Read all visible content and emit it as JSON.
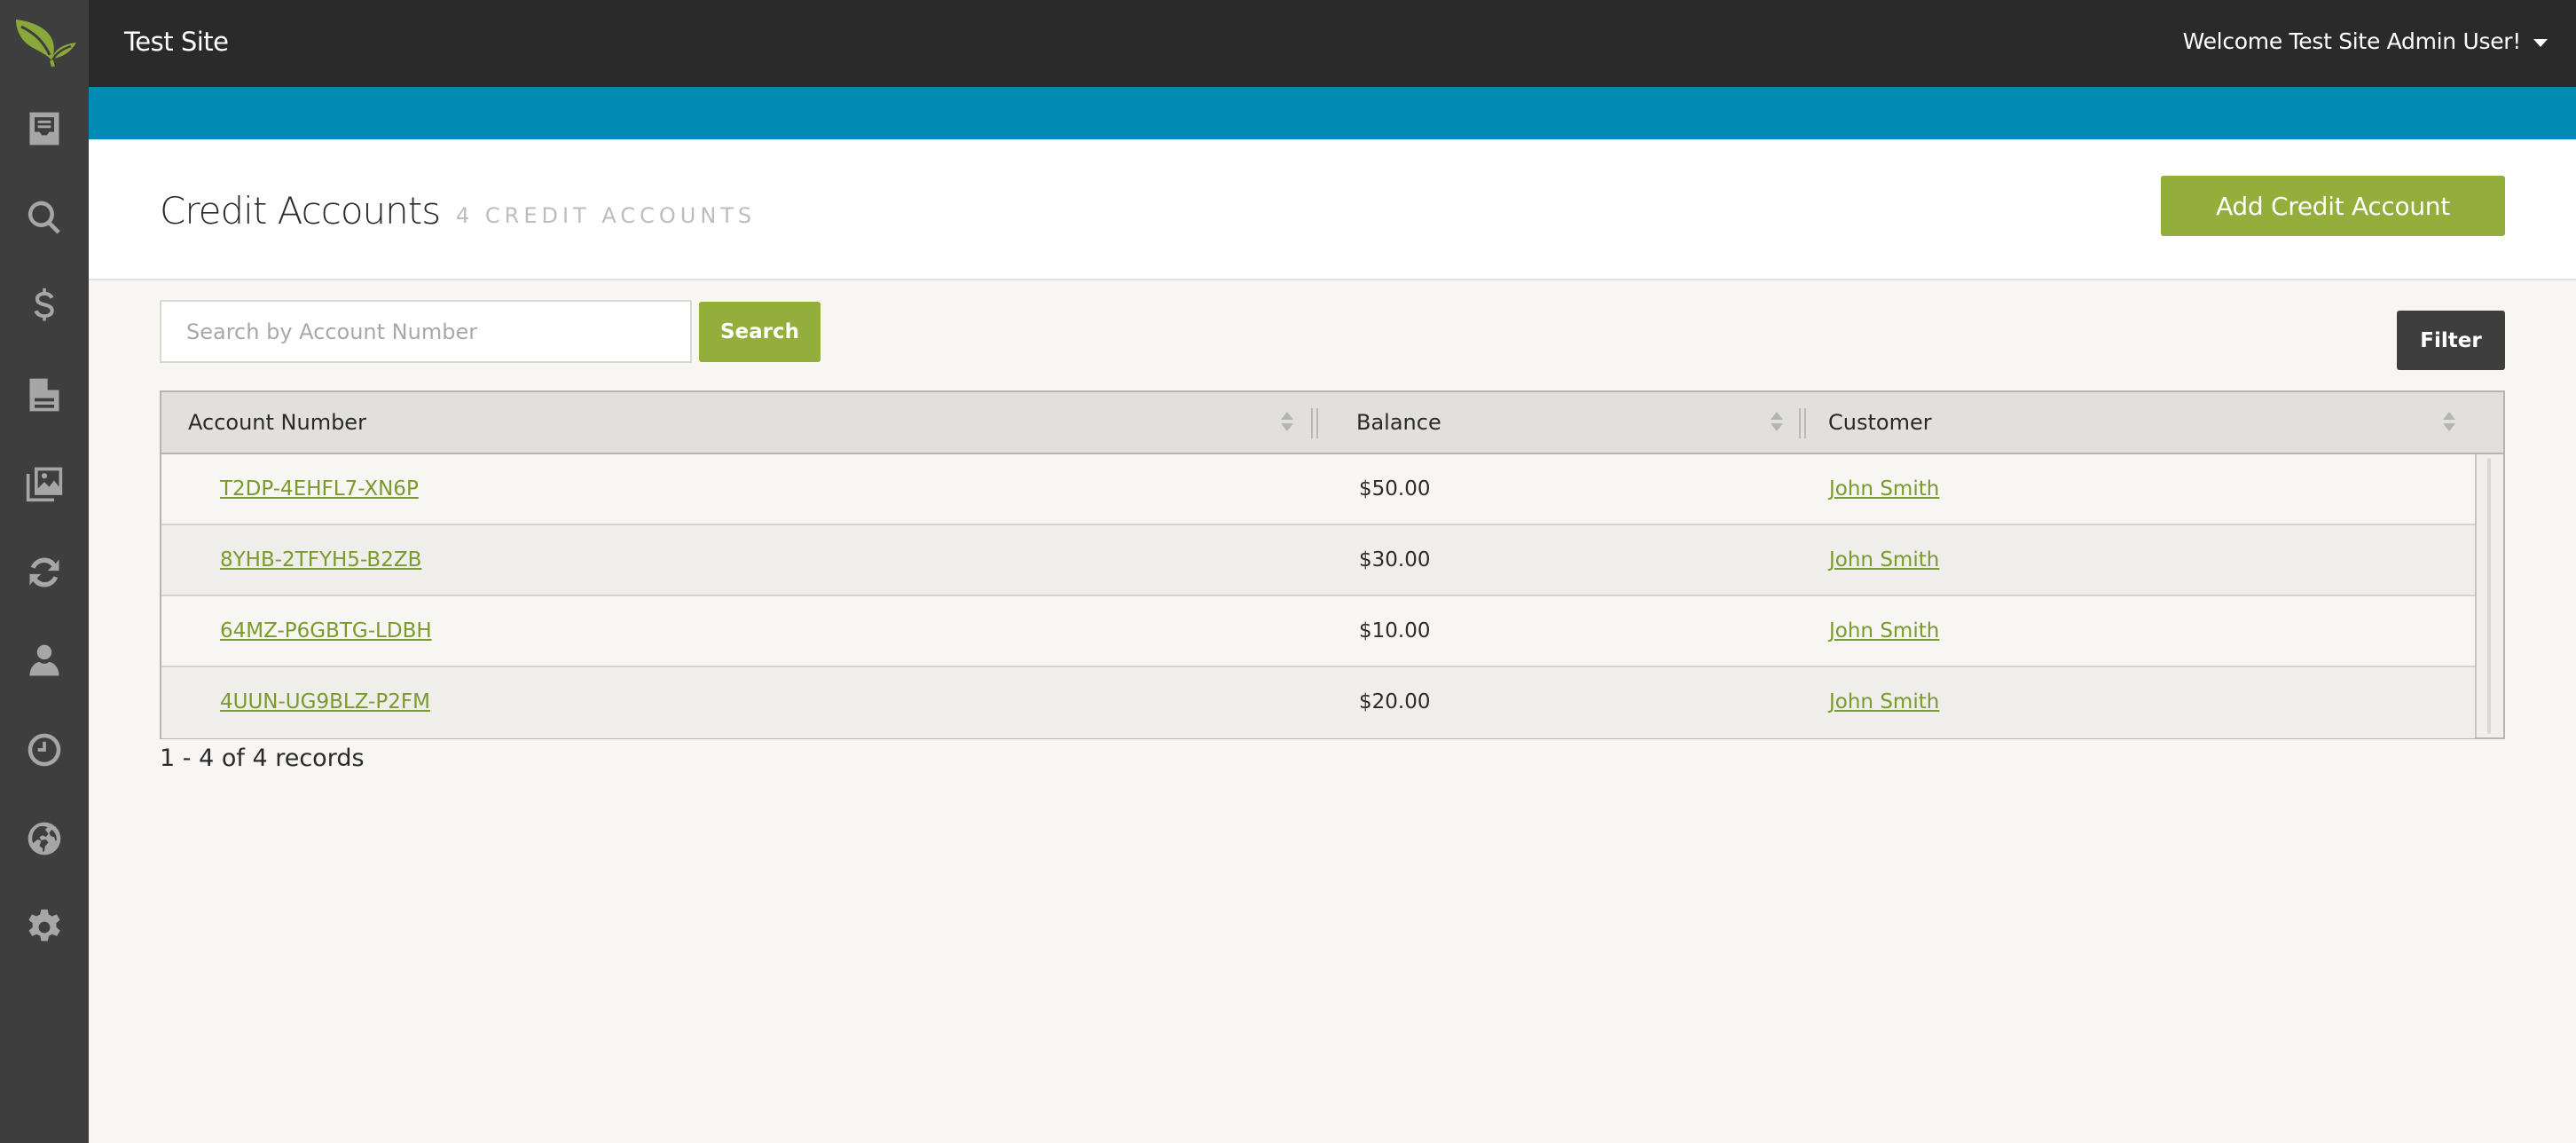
{
  "app": {
    "site_title": "Test Site",
    "user_greeting": "Welcome Test Site Admin User!"
  },
  "sidebar": {
    "items": [
      {
        "name": "orders",
        "icon": "inbox-icon"
      },
      {
        "name": "search",
        "icon": "search-icon"
      },
      {
        "name": "billing",
        "icon": "dollar-icon"
      },
      {
        "name": "pages",
        "icon": "document-icon"
      },
      {
        "name": "media",
        "icon": "images-icon"
      },
      {
        "name": "sync",
        "icon": "refresh-icon"
      },
      {
        "name": "users",
        "icon": "user-icon"
      },
      {
        "name": "history",
        "icon": "clock-icon"
      },
      {
        "name": "sites",
        "icon": "globe-icon"
      },
      {
        "name": "settings",
        "icon": "gear-icon"
      }
    ]
  },
  "page": {
    "title": "Credit Accounts",
    "count_label": "4 Credit Accounts",
    "add_button": "Add Credit Account"
  },
  "search": {
    "placeholder": "Search by Account Number",
    "value": "",
    "button": "Search"
  },
  "filter": {
    "button": "Filter"
  },
  "table": {
    "columns": [
      "Account Number",
      "Balance",
      "Customer"
    ],
    "rows": [
      {
        "account_number": "T2DP-4EHFL7-XN6P",
        "balance": "$50.00",
        "customer": "John Smith"
      },
      {
        "account_number": "8YHB-2TFYH5-B2ZB",
        "balance": "$30.00",
        "customer": "John Smith"
      },
      {
        "account_number": "64MZ-P6GBTG-LDBH",
        "balance": "$10.00",
        "customer": "John Smith"
      },
      {
        "account_number": "4UUN-UG9BLZ-P2FM",
        "balance": "$20.00",
        "customer": "John Smith"
      }
    ]
  },
  "pager": {
    "info": "1 - 4 of 4 records"
  },
  "colors": {
    "sidebar": "#3e3e3e",
    "topbar": "#2a2a2a",
    "accent_blue": "#008ab4",
    "brand_green": "#93ae3a",
    "link_green": "#7a9a2c",
    "dark_button": "#3e3e3e"
  }
}
